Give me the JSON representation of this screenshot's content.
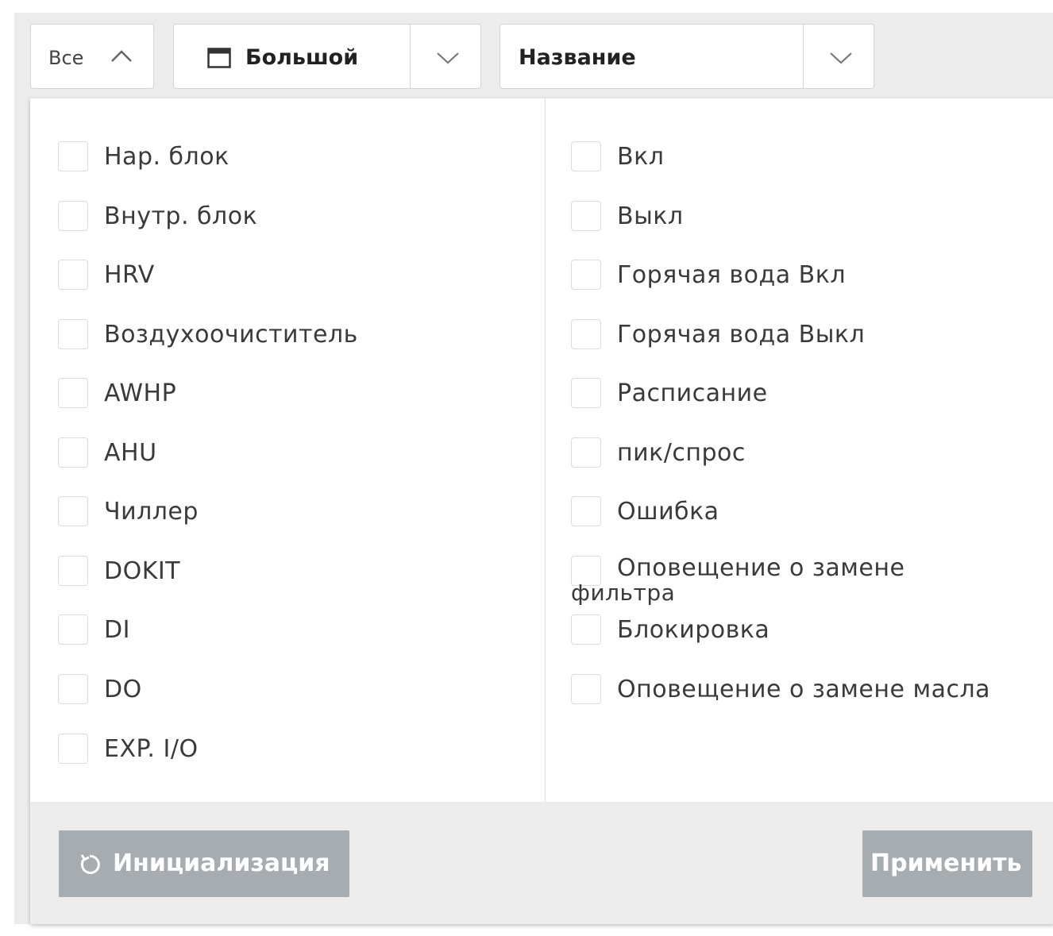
{
  "toolbar": {
    "filter_toggle_label": "Все",
    "view_size_value": "Большой",
    "sort_value": "Название"
  },
  "filters": {
    "device_types": [
      {
        "label": "Нар. блок",
        "checked": false
      },
      {
        "label": "Внутр. блок",
        "checked": false
      },
      {
        "label": "HRV",
        "checked": false
      },
      {
        "label": "Воздухоочиститель",
        "checked": false
      },
      {
        "label": "AWHP",
        "checked": false
      },
      {
        "label": "AHU",
        "checked": false
      },
      {
        "label": "Чиллер",
        "checked": false
      },
      {
        "label": "DOKIT",
        "checked": false
      },
      {
        "label": "DI",
        "checked": false
      },
      {
        "label": "DO",
        "checked": false
      },
      {
        "label": "EXP. I/O",
        "checked": false
      }
    ],
    "statuses": [
      {
        "label": "Вкл",
        "checked": false
      },
      {
        "label": "Выкл",
        "checked": false
      },
      {
        "label": "Горячая вода Вкл",
        "checked": false
      },
      {
        "label": "Горячая вода Выкл",
        "checked": false
      },
      {
        "label": "Расписание",
        "checked": false
      },
      {
        "label": "пик/спрос",
        "checked": false
      },
      {
        "label": "Ошибка",
        "checked": false
      },
      {
        "label": "Оповещение о замене",
        "label_line2": "фильтра",
        "checked": false
      },
      {
        "label": "Блокировка",
        "checked": false
      },
      {
        "label": "Оповещение о замене масла",
        "checked": false
      }
    ]
  },
  "footer": {
    "reset_label": "Инициализация",
    "apply_label": "Применить"
  },
  "colors": {
    "toolbar_bg": "#ececec",
    "button_bg": "#a7acb0",
    "button_text": "#ffffff",
    "checkbox_border": "#dcdcdc"
  }
}
